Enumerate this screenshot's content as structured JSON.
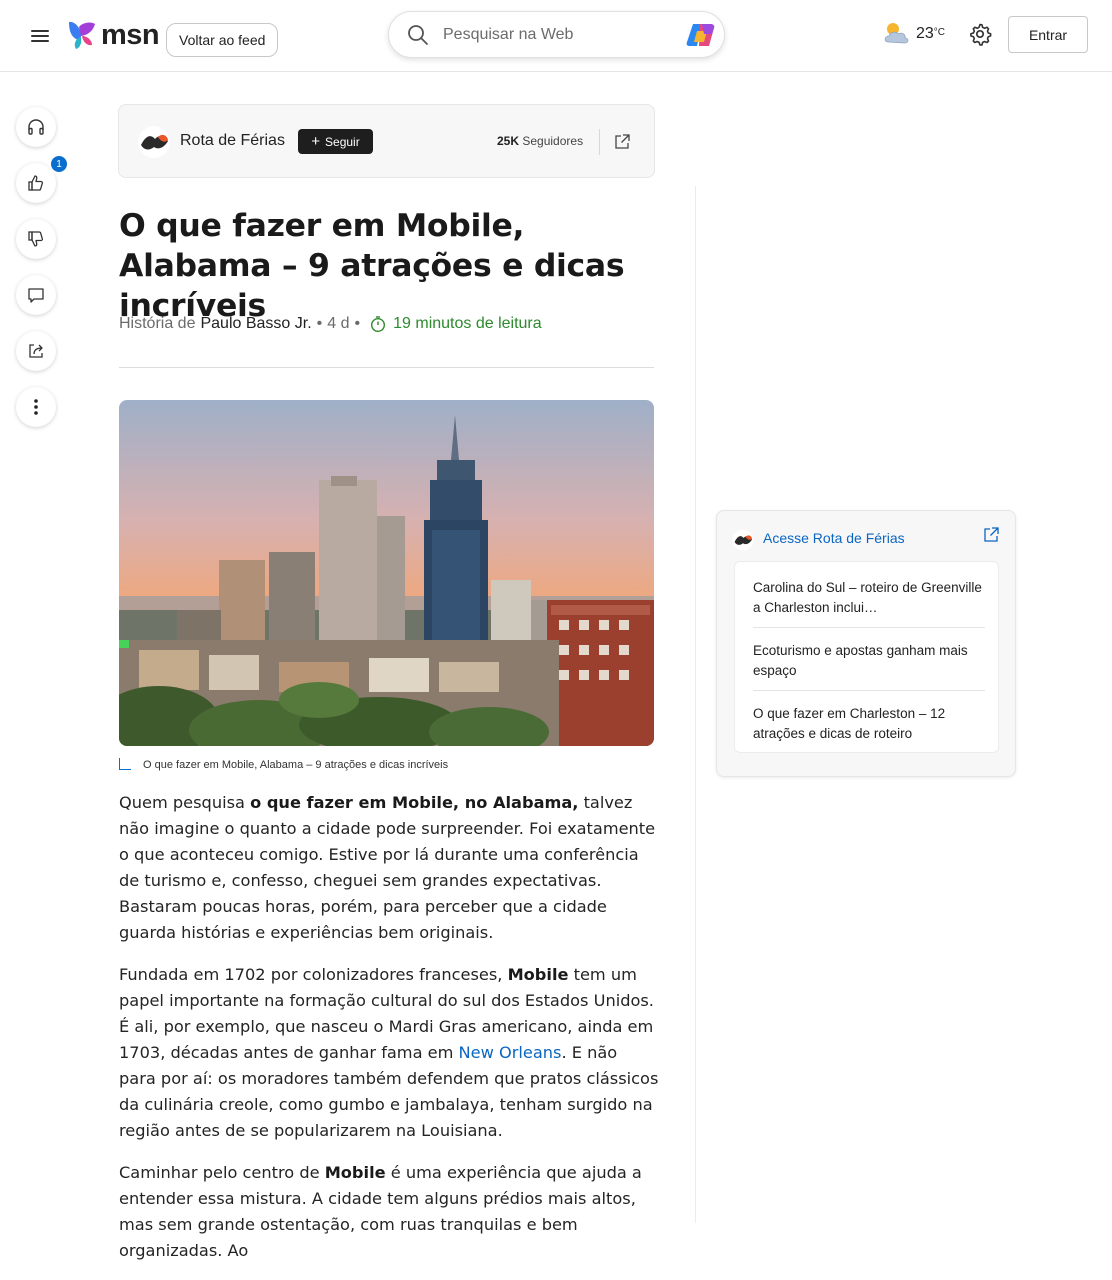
{
  "topbar": {
    "logo_text": "msn",
    "back_to_feed": "Voltar ao feed",
    "search_placeholder": "Pesquisar na Web",
    "weather_temp": "23",
    "weather_unit": "°C",
    "signin": "Entrar"
  },
  "rail": {
    "like_count": "1"
  },
  "publisher": {
    "name": "Rota de Férias",
    "follow": "Seguir",
    "followers_count": "25K",
    "followers_label": "Seguidores"
  },
  "article": {
    "title": "O que fazer em Mobile, Alabama – 9 atrações e dicas incríveis",
    "byline_prefix": "História de",
    "author": "Paulo Basso Jr.",
    "age": "4 d",
    "read_time": "19 minutos de leitura",
    "image_caption": "O que fazer em Mobile, Alabama – 9 atrações e dicas incríveis",
    "p1_a": "Quem pesquisa ",
    "p1_b": "o que fazer em Mobile, no Alabama,",
    "p1_c": " talvez não imagine o quanto a cidade pode surpreender. Foi exatamente o que aconteceu comigo. Estive por lá durante uma conferência de turismo e, confesso, cheguei sem grandes expectativas. Bastaram poucas horas, porém, para perceber que a cidade guarda histórias e experiências bem originais.",
    "p2_a": "Fundada em 1702 por colonizadores franceses, ",
    "p2_b": "Mobile",
    "p2_c": " tem um papel importante na formação cultural do sul dos Estados Unidos. É ali, por exemplo, que nasceu o Mardi Gras americano, ainda em 1703, décadas antes de ganhar fama em ",
    "p2_link": "New Orleans",
    "p2_d": ". E não para por aí: os moradores também defendem que pratos clássicos da culinária creole, como gumbo e jambalaya, tenham surgido na região antes de se popularizarem na Louisiana.",
    "p3_a": "Caminhar pelo centro de ",
    "p3_b": "Mobile",
    "p3_c": " é uma experiência que ajuda a entender essa mistura. A cidade tem alguns prédios mais altos, mas sem grande ostentação, com ruas tranquilas e bem organizadas. Ao"
  },
  "sidebar": {
    "title": "Acesse Rota de Férias",
    "items": [
      "Carolina do Sul – roteiro de Greenville a Charleston inclui…",
      "Ecoturismo e apostas ganham mais espaço",
      "O que fazer em Charleston – 12 atrações e dicas de roteiro"
    ]
  },
  "colors": {
    "accent_blue": "#0a66c2",
    "read_time_green": "#2d8a2d",
    "badge_blue": "#0a6ecf"
  }
}
